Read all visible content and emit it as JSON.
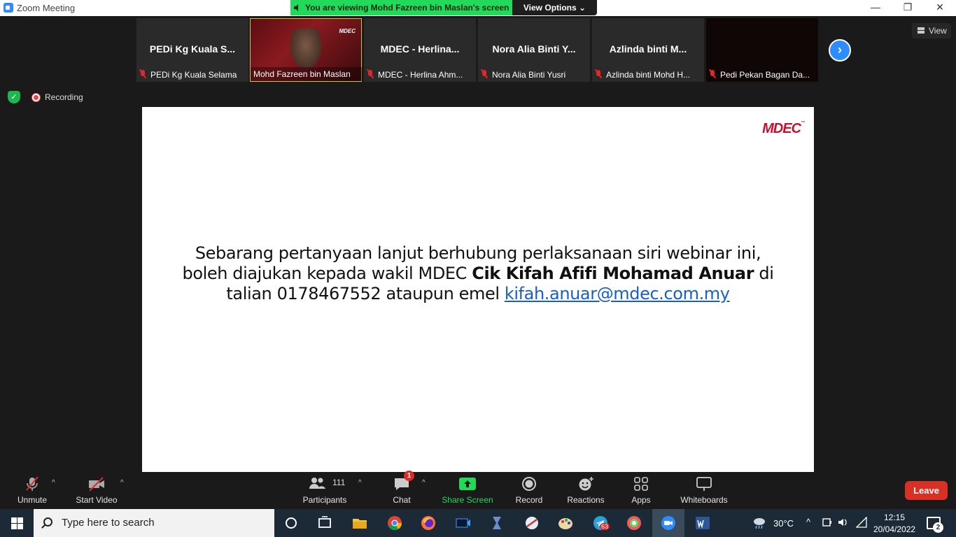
{
  "window": {
    "title": "Zoom Meeting",
    "minimize": "—",
    "maximize": "❐",
    "close": "✕"
  },
  "banner": {
    "viewing": "You are viewing Mohd Fazreen bin Maslan's screen",
    "view_options": "View Options",
    "view_options_caret": "⌄"
  },
  "view_button": "View",
  "recording": "Recording",
  "gallery": {
    "tiles": [
      {
        "big_name": "PEDi Kg Kuala S...",
        "label": "PEDi Kg Kuala Selama"
      },
      {
        "big_name": "",
        "label": "Mohd Fazreen bin Maslan",
        "logo": "MDEC"
      },
      {
        "big_name": "MDEC - Herlina...",
        "label": "MDEC - Herlina Ahm..."
      },
      {
        "big_name": "Nora Alia Binti Y...",
        "label": "Nora Alia Binti Yusri"
      },
      {
        "big_name": "Azlinda binti M...",
        "label": "Azlinda binti Mohd H..."
      },
      {
        "big_name": "",
        "label": "Pedi Pekan Bagan Da..."
      }
    ],
    "next_arrow": "›"
  },
  "slide": {
    "logo": "MDEC",
    "logo_tm": "™",
    "line1": "Sebarang pertanyaan lanjut berhubung perlaksanaan siri webinar ini,",
    "line2_start": "boleh diajukan kepada wakil MDEC ",
    "line2_bold": "Cik Kifah Afifi Mohamad Anuar",
    "line2_end": " di",
    "line3_start": "talian 0178467552 ataupun emel ",
    "email": "kifah.anuar@mdec.com.my"
  },
  "toolbar": {
    "unmute": "Unmute",
    "start_video": "Start Video",
    "participants": "Participants",
    "participants_count": "111",
    "chat": "Chat",
    "chat_badge": "1",
    "share_screen": "Share Screen",
    "record": "Record",
    "reactions": "Reactions",
    "apps": "Apps",
    "whiteboards": "Whiteboards",
    "leave": "Leave",
    "caret": "^"
  },
  "taskbar": {
    "search_placeholder": "Type here to search",
    "temperature": "30°C",
    "time": "12:15",
    "date": "20/04/2022",
    "telegram_badge": "63",
    "notification_count": "2"
  },
  "colors": {
    "accent_green": "#23d959",
    "zoom_blue": "#2d8cff",
    "leave_red": "#d93025",
    "mdec_red": "#c8102e"
  }
}
